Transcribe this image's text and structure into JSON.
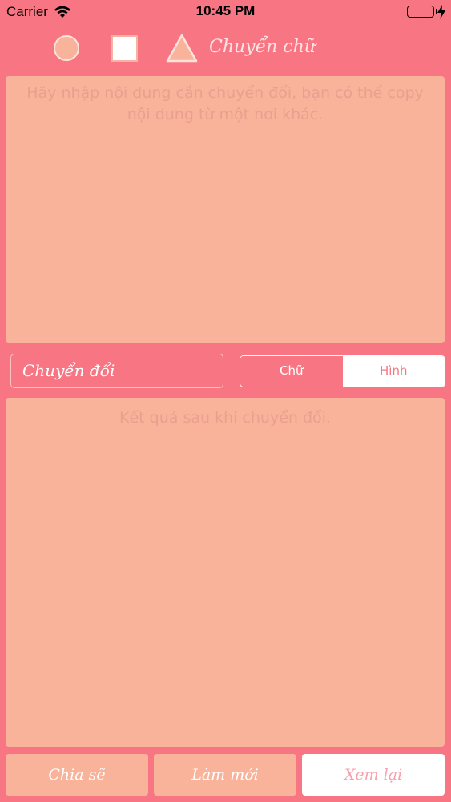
{
  "status_bar": {
    "carrier": "Carrier",
    "time": "10:45 PM",
    "wifi_icon": "wifi-icon",
    "battery_icon": "battery-icon",
    "charging_icon": "bolt-icon"
  },
  "toolbar": {
    "shapes": [
      "circle-icon",
      "square-icon",
      "triangle-icon"
    ],
    "title": "Chuyển chữ"
  },
  "input": {
    "placeholder": "Hãy nhập nội dung cần chuyển đổi, bạn có thể copy nội dung từ một nơi khác."
  },
  "controls": {
    "convert_label": "Chuyển đổi",
    "segments": [
      {
        "label": "Chữ",
        "selected": true
      },
      {
        "label": "Hình",
        "selected": false
      }
    ]
  },
  "output": {
    "placeholder": "Kết quả sau khi chuyển đổi."
  },
  "bottom": {
    "share_label": "Chia sẽ",
    "reset_label": "Làm mới",
    "review_label": "Xem lại"
  },
  "colors": {
    "background": "#f87683",
    "panel": "#f8b39a",
    "placeholder_text": "#e9a090",
    "white": "#ffffff"
  }
}
